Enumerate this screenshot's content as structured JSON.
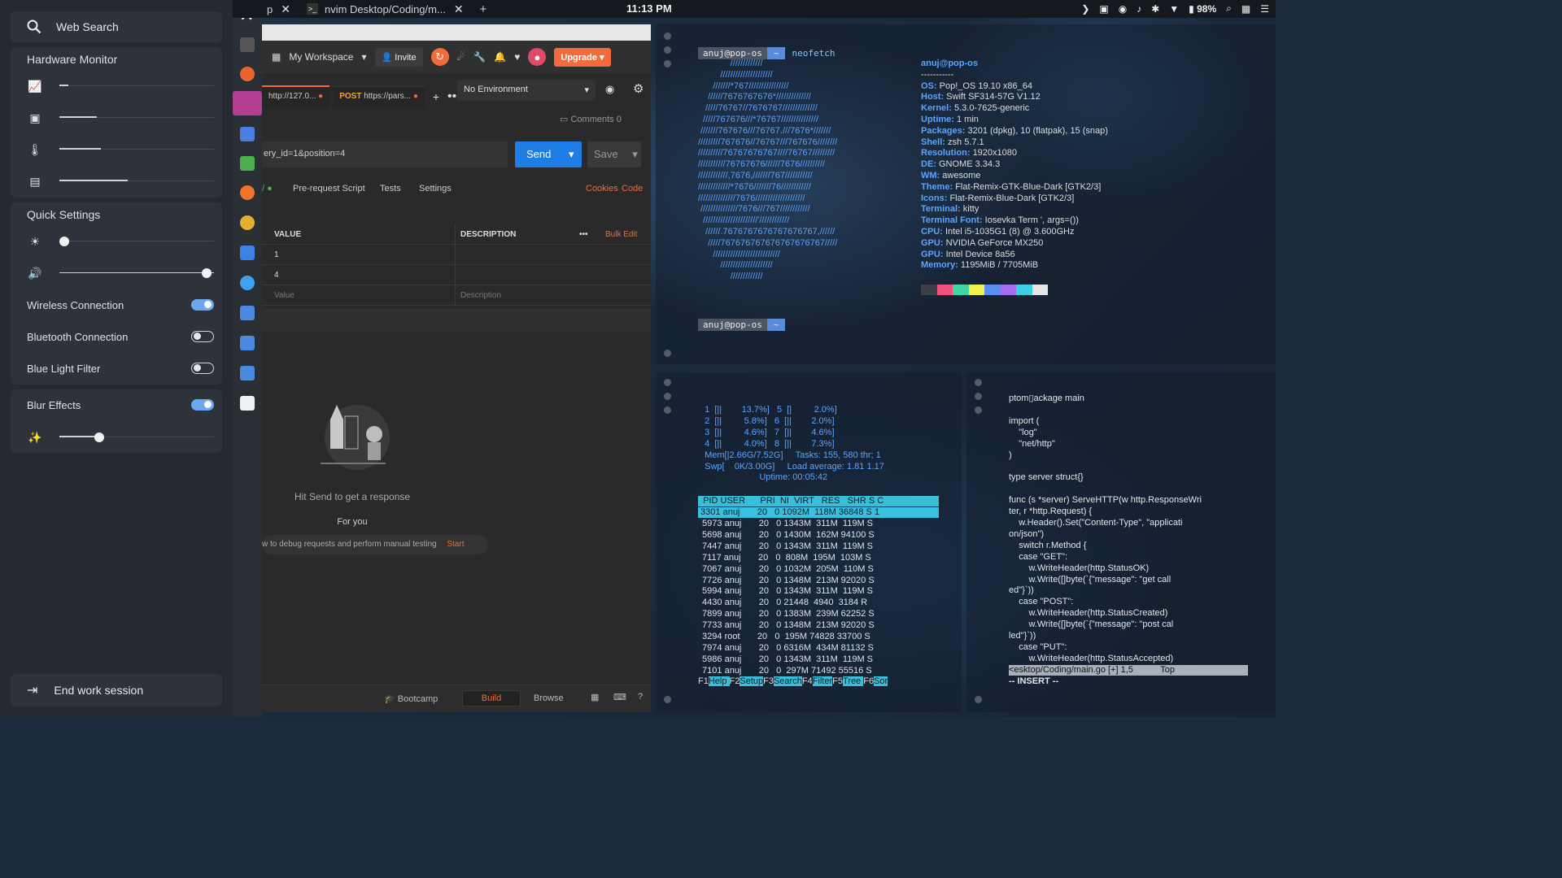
{
  "topbar": {
    "tabs": [
      {
        "label": "p",
        "close": "✕"
      },
      {
        "label": "nvim Desktop/Coding/m...",
        "close": "✕"
      }
    ],
    "new_tab": "+",
    "clock": "11:13 PM",
    "battery": "98%"
  },
  "panel": {
    "search": {
      "label": "Web Search"
    },
    "hardware": {
      "title": "Hardware Monitor",
      "rows": [
        {
          "icon": "chart-icon",
          "level": 0.06
        },
        {
          "icon": "cpu-icon",
          "level": 0.24
        },
        {
          "icon": "thermometer-icon",
          "level": 0.27
        },
        {
          "icon": "memory-icon",
          "level": 0.44
        }
      ]
    },
    "quick": {
      "title": "Quick Settings",
      "brightness": 0.03,
      "volume": 0.95,
      "toggles": [
        {
          "label": "Wireless Connection",
          "on": true
        },
        {
          "label": "Bluetooth Connection",
          "on": false
        },
        {
          "label": "Blue Light Filter",
          "on": false
        }
      ]
    },
    "blur": {
      "label": "Blur Effects",
      "on": true,
      "level": 0.26
    },
    "end_session": "End work session"
  },
  "postman": {
    "workspace": "My Workspace",
    "invite": "Invite",
    "upgrade": "Upgrade",
    "tabs": [
      {
        "method": "",
        "url": "http://127.0..."
      },
      {
        "method": "POST",
        "url": "https://pars..."
      }
    ],
    "environment": "No Environment",
    "comments": "Comments",
    "comments_count": "0",
    "url_value": "ery_id=1&position=4",
    "send": "Send",
    "save": "Save",
    "subtabs": [
      "Pre-request Script",
      "Tests",
      "Settings"
    ],
    "links": {
      "cookies": "Cookies",
      "code": "Code"
    },
    "table": {
      "headers": [
        "VALUE",
        "DESCRIPTION"
      ],
      "bulk_edit": "Bulk Edit",
      "rows": [
        [
          "1",
          ""
        ],
        [
          "4",
          ""
        ]
      ],
      "placeholder": [
        "Value",
        "Description"
      ]
    },
    "empty_text": "Hit Send to get a response",
    "for_you": "For you",
    "tip": "w to debug requests and perform manual testing",
    "tip_action": "Start",
    "footer": {
      "bootcamp": "Bootcamp",
      "build": "Build",
      "browse": "Browse"
    }
  },
  "neofetch": {
    "prompt_user": "anuj@pop-os",
    "prompt_arrow": "~",
    "command": "neofetch",
    "art": [
      "             /////////////",
      "         /////////////////////",
      "      ///////*767////////////////",
      "    //////7676767676*//////////////",
      "   /////76767//7676767//////////////",
      "  /////767676///*76767///////////////",
      " ///////767676///76767.///7676*///////",
      "/////////767676//76767///767676////////",
      "//////////76767676767////76767/////////",
      "///////////76767676//////7676//////////",
      "////////////,7676,///////767///////////",
      "/////////////*7676///////76////////////",
      "///////////////7676////////////////////",
      " ///////////////7676///767////////////",
      "  //////////////////////'////////////",
      "   //////.7676767676767676767,//////",
      "    /////767676767676767676767/////",
      "      ///////////////////////////",
      "         /////////////////////",
      "             /////////////"
    ],
    "header": "anuj@pop-os",
    "sep": "-----------",
    "info": [
      {
        "k": "OS",
        "v": "Pop!_OS 19.10 x86_64"
      },
      {
        "k": "Host",
        "v": "Swift SF314-57G V1.12"
      },
      {
        "k": "Kernel",
        "v": "5.3.0-7625-generic"
      },
      {
        "k": "Uptime",
        "v": "1 min"
      },
      {
        "k": "Packages",
        "v": "3201 (dpkg), 10 (flatpak), 15 (snap)"
      },
      {
        "k": "Shell",
        "v": "zsh 5.7.1"
      },
      {
        "k": "Resolution",
        "v": "1920x1080"
      },
      {
        "k": "DE",
        "v": "GNOME 3.34.3"
      },
      {
        "k": "WM",
        "v": "awesome"
      },
      {
        "k": "Theme",
        "v": "Flat-Remix-GTK-Blue-Dark [GTK2/3]"
      },
      {
        "k": "Icons",
        "v": "Flat-Remix-Blue-Dark [GTK2/3]"
      },
      {
        "k": "Terminal",
        "v": "kitty"
      },
      {
        "k": "Terminal Font",
        "v": "Iosevka Term ', args=())"
      },
      {
        "k": "CPU",
        "v": "Intel i5-1035G1 (8) @ 3.600GHz"
      },
      {
        "k": "GPU",
        "v": "NVIDIA GeForce MX250"
      },
      {
        "k": "GPU",
        "v": "Intel Device 8a56"
      },
      {
        "k": "Memory",
        "v": "1195MiB / 7705MiB"
      }
    ],
    "palette": [
      "#3c3f46",
      "#f2537a",
      "#3fd6a3",
      "#f1f14d",
      "#5a8ef0",
      "#a56ef0",
      "#3cd1e0",
      "#e6e6e6"
    ],
    "prompt2_user": "anuj@pop-os"
  },
  "htop": {
    "cpu_lines": [
      "  1  [||        13.7%]   5  [|         2.0%]",
      "  2  [||         5.8%]   6  [||        2.0%]",
      "  3  [||         4.6%]   7  [||        4.6%]",
      "  4  [||         4.0%]   8  [||        7.3%]",
      "  Mem[|2.66G/7.52G]     Tasks: 155, 580 thr; 1",
      "  Swp[    0K/3.00G]     Load average: 1.81 1.17",
      "                        Uptime: 00:05:42"
    ],
    "header": "  PID USER      PRI  NI  VIRT   RES   SHR S C",
    "selected": " 3301 anuj       20   0 1092M  118M 36848 S 1",
    "rows": [
      " 5973 anuj       20   0 1343M  311M  119M S",
      " 5698 anuj       20   0 1430M  162M 94100 S",
      " 7447 anuj       20   0 1343M  311M  119M S",
      " 7117 anuj       20   0  808M  195M  103M S",
      " 7067 anuj       20   0 1032M  205M  110M S",
      " 7726 anuj       20   0 1348M  213M 92020 S",
      " 5994 anuj       20   0 1343M  311M  119M S",
      " 4430 anuj       20   0 21448  4940  3184 R",
      " 7899 anuj       20   0 1383M  239M 62252 S",
      " 7733 anuj       20   0 1348M  213M 92020 S",
      " 3294 root       20   0  195M 74828 33700 S",
      " 7974 anuj       20   0 6316M  434M 81132 S",
      " 5986 anuj       20   0 1343M  311M  119M S",
      " 7101 anuj       20   0  297M 71492 55516 S"
    ],
    "fkeys": [
      {
        "k": "F1",
        "v": "Help"
      },
      {
        "k": "F2",
        "v": "Setup"
      },
      {
        "k": "F3",
        "v": "Search"
      },
      {
        "k": "F4",
        "v": "Filter"
      },
      {
        "k": "F5",
        "v": "Tree"
      },
      {
        "k": "F6",
        "v": "Sor"
      }
    ]
  },
  "vim": {
    "lines": [
      "ptom▯ackage main",
      "",
      "import (",
      "    \"log\"",
      "    \"net/http\"",
      ")",
      "",
      "type server struct{}",
      "",
      "func (s *server) ServeHTTP(w http.ResponseWri",
      "ter, r *http.Request) {",
      "    w.Header().Set(\"Content-Type\", \"applicati",
      "on/json\")",
      "    switch r.Method {",
      "    case \"GET\":",
      "        w.WriteHeader(http.StatusOK)",
      "        w.Write([]byte(`{\"message\": \"get call",
      "ed\"}`))",
      "    case \"POST\":",
      "        w.WriteHeader(http.StatusCreated)",
      "        w.Write([]byte(`{\"message\": \"post cal",
      "led\"}`))",
      "    case \"PUT\":",
      "        w.WriteHeader(http.StatusAccepted)"
    ],
    "status": "<esktop/Coding/main.go [+] 1,5           Top",
    "mode": "-- INSERT --"
  }
}
